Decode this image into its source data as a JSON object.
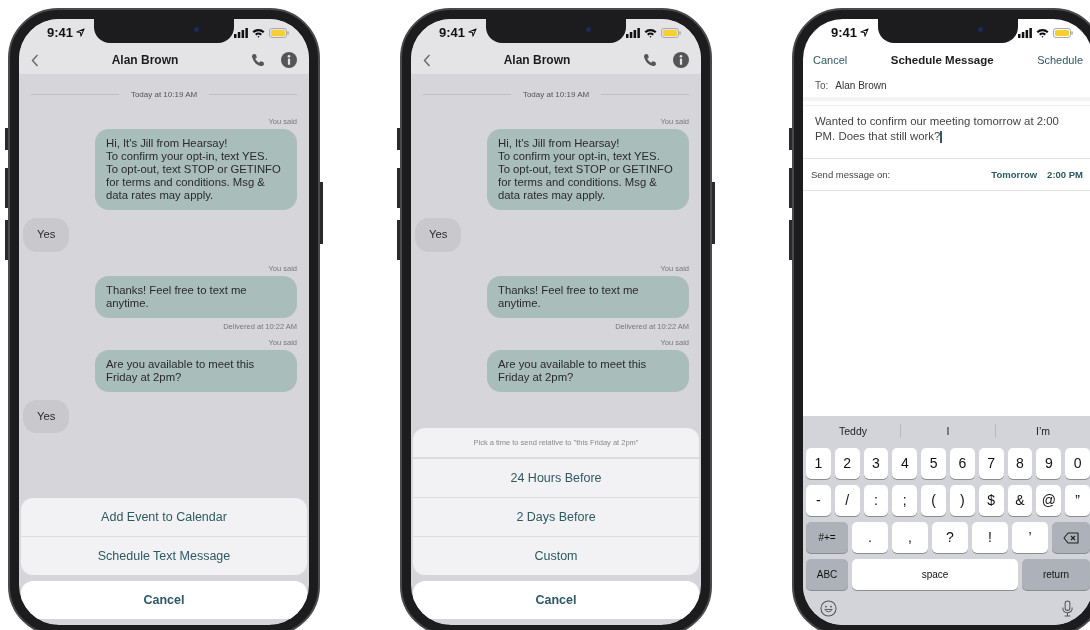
{
  "phones": [
    {
      "kind": "chat",
      "status": {
        "time": "9:41"
      },
      "nav": {
        "title": "Alan Brown"
      },
      "messages": [
        {
          "kind": "divider",
          "text": "Today at 10:19 AM"
        },
        {
          "kind": "outgoing",
          "label": "You said",
          "text": "Hi, It's Jill from Hearsay!\nTo confirm your opt-in, text YES.\nTo opt-out, text STOP or GETINFO for terms and conditions. Msg & data rates may apply."
        },
        {
          "kind": "incoming",
          "text": "Yes"
        },
        {
          "kind": "outgoing",
          "label": "You said",
          "text": "Thanks! Feel free to text me anytime.",
          "status": "Delivered at 10:22 AM"
        },
        {
          "kind": "outgoing",
          "label": "You said",
          "text": "Are you available to meet this Friday at 2pm?"
        },
        {
          "kind": "incoming",
          "text": "Yes"
        }
      ],
      "sheet": {
        "options": [
          "Add Event to Calendar",
          "Schedule Text Message"
        ],
        "cancel": "Cancel"
      }
    },
    {
      "kind": "chat",
      "status": {
        "time": "9:41"
      },
      "nav": {
        "title": "Alan Brown"
      },
      "messages": [
        {
          "kind": "divider",
          "text": "Today at 10:19 AM"
        },
        {
          "kind": "outgoing",
          "label": "You said",
          "text": "Hi, It's Jill from Hearsay!\nTo confirm your opt-in, text YES.\nTo opt-out, text STOP or GETINFO for terms and conditions. Msg & data rates may apply."
        },
        {
          "kind": "incoming",
          "text": "Yes"
        },
        {
          "kind": "outgoing",
          "label": "You said",
          "text": "Thanks! Feel free to text me anytime.",
          "status": "Delivered at 10:22 AM"
        },
        {
          "kind": "outgoing",
          "label": "You said",
          "text": "Are you available to meet this Friday at 2pm?"
        }
      ],
      "sheet": {
        "header": "Pick a time to send relative to \"this Friday at 2pm\"",
        "options": [
          "24 Hours Before",
          "2 Days Before",
          "Custom"
        ],
        "cancel": "Cancel"
      }
    },
    {
      "kind": "compose",
      "status": {
        "time": "9:41"
      },
      "nav": {
        "cancel": "Cancel",
        "title": "Schedule Message",
        "action": "Schedule"
      },
      "to": {
        "label": "To:",
        "value": "Alan Brown"
      },
      "message": {
        "value": "Wanted to confirm our meeting tomorrow at 2:00 PM. Does that still work?"
      },
      "send": {
        "label": "Send message on:",
        "date": "Tomorrow",
        "time": "2:00 PM"
      },
      "keyboard": {
        "suggestions": [
          "Teddy",
          "I",
          "I’m"
        ],
        "number_row": [
          {
            "kind": "char",
            "label": "1"
          },
          {
            "kind": "char",
            "label": "2"
          },
          {
            "kind": "char",
            "label": "3"
          },
          {
            "kind": "char",
            "label": "4"
          },
          {
            "kind": "char",
            "label": "5"
          },
          {
            "kind": "char",
            "label": "6"
          },
          {
            "kind": "char",
            "label": "7"
          },
          {
            "kind": "char",
            "label": "8"
          },
          {
            "kind": "char",
            "label": "9"
          },
          {
            "kind": "char",
            "label": "0"
          }
        ],
        "symbol_row": [
          {
            "kind": "char",
            "label": "-"
          },
          {
            "kind": "char",
            "label": "/"
          },
          {
            "kind": "char",
            "label": ":"
          },
          {
            "kind": "char",
            "label": ";"
          },
          {
            "kind": "char",
            "label": "("
          },
          {
            "kind": "char",
            "label": ")"
          },
          {
            "kind": "char",
            "label": "$"
          },
          {
            "kind": "char",
            "label": "&"
          },
          {
            "kind": "char",
            "label": "@"
          },
          {
            "kind": "char",
            "label": "”"
          }
        ],
        "punctuation_row": [
          {
            "kind": "mod",
            "label": "#+="
          },
          {
            "kind": "wide",
            "label": "."
          },
          {
            "kind": "wide",
            "label": ","
          },
          {
            "kind": "wide",
            "label": "?"
          },
          {
            "kind": "wide",
            "label": "!"
          },
          {
            "kind": "wide",
            "label": "’"
          },
          {
            "kind": "delete"
          }
        ],
        "bottom_row": [
          {
            "kind": "mod",
            "label": "ABC"
          },
          {
            "kind": "space",
            "label": "space"
          },
          {
            "kind": "mod",
            "label": "return"
          }
        ]
      }
    }
  ]
}
